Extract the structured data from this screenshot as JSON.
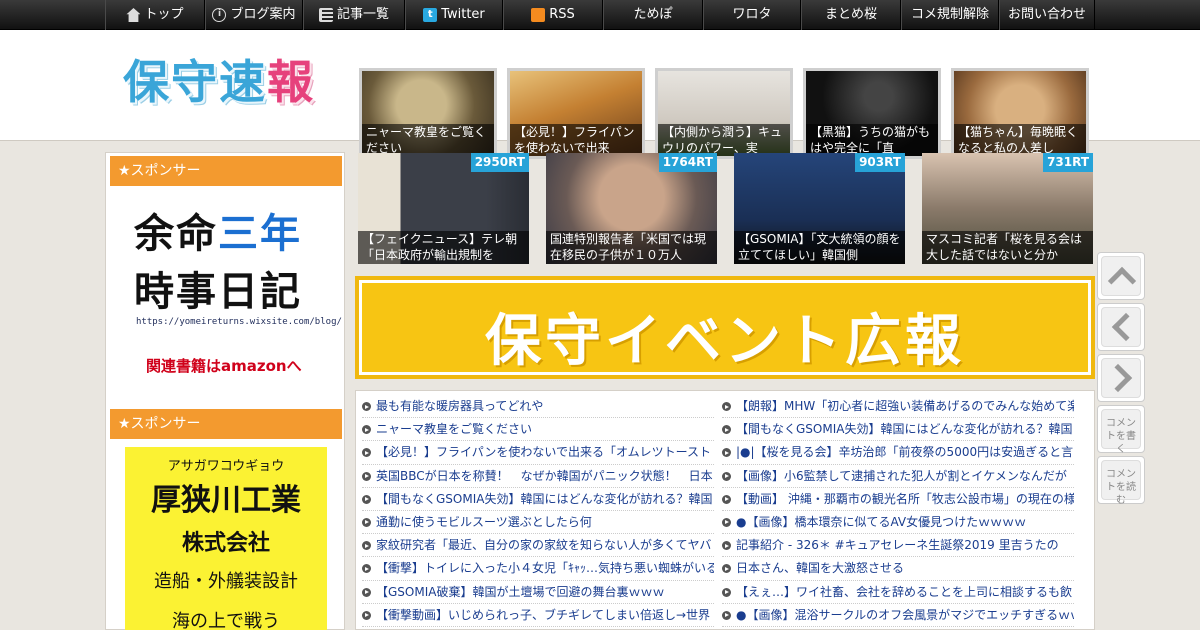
{
  "nav": {
    "items": [
      {
        "label": "トップ",
        "icon": "home-icon"
      },
      {
        "label": "ブログ案内",
        "icon": "info-icon"
      },
      {
        "label": "記事一覧",
        "icon": "list-icon"
      },
      {
        "label": "Twitter",
        "icon": "twitter-icon"
      },
      {
        "label": "RSS",
        "icon": "rss-icon"
      },
      {
        "label": "ためぽ"
      },
      {
        "label": "ワロタ"
      },
      {
        "label": "まとめ桜"
      },
      {
        "label": "コメ規制解除"
      },
      {
        "label": "お問い合わせ"
      }
    ]
  },
  "header": {
    "logo": {
      "part1": "保守",
      "part2": "速",
      "part3": "報"
    },
    "thumbs": [
      {
        "caption": "ニャーマ教皇をご覧ください",
        "color": "#7a6a4a"
      },
      {
        "caption": "【必見！】フライパンを使わないで出来",
        "color": "#b4783a"
      },
      {
        "caption": "【内側から潤う】キュウリのパワー、実",
        "color": "#c9c3b9"
      },
      {
        "caption": "【黒猫】うちの猫がもはや完全に「直",
        "color": "#2a2a2a"
      },
      {
        "caption": "【猫ちゃん】毎晩眠くなると私の人差し",
        "color": "#b38a5c"
      }
    ]
  },
  "sidebar": {
    "sponsor_title_1": "★スポンサー",
    "sponsor_title_2": "★スポンサー",
    "ad1": {
      "line1a": "余命",
      "line1b": "三年",
      "line2": "時事日記",
      "url": "https://yomeireturns.wixsite.com/blog/",
      "amazon": "関連書籍はamazonへ"
    },
    "ad2": {
      "kana": "アサガワコウギョウ",
      "name": "厚狭川工業",
      "corp": "株式会社",
      "biz": "造船・外艤装設計",
      "more": "海の上で戦う"
    }
  },
  "ranking": [
    {
      "rt": "2950RT",
      "caption": "【フェイクニュース】テレ朝「日本政府が輸出規制を",
      "color": "#4a4f5a"
    },
    {
      "rt": "1764RT",
      "caption": "国連特別報告者「米国では現在移民の子供が１０万人",
      "color": "#7b6e66"
    },
    {
      "rt": "903RT",
      "caption": "【GSOMIA】「文大統領の顔を立ててほしい」韓国側",
      "color": "#203a6a"
    },
    {
      "rt": "731RT",
      "caption": "マスコミ記者「桜を見る会は大した話ではないと分か",
      "color": "#6f7f5a"
    }
  ],
  "banner": {
    "text": "保守イベント広報"
  },
  "articles": {
    "left": [
      "最も有能な暖房器具ってどれや",
      "ニャーマ教皇をご覧ください",
      "【必見！】フライパンを使わないで出来る「オムレツトースト",
      "英国BBCが日本を称賛！　なぜか韓国がパニック状態！　日本",
      "【間もなくGSOMIA失効】韓国にはどんな変化が訪れる？韓国",
      "通勤に使うモビルスーツ選ぶとしたら何",
      "家紋研究者「最近、自分の家の家紋を知らない人が多くてヤバ",
      "【衝撃】トイレに入った小４女児「ｷｬｯ…気持ち悪い蜘蛛がいる",
      "【GSOMIA破棄】韓国が土壇場で回避の舞台裏ｗｗｗ",
      "【衝撃動画】いじめられっ子、ブチギレてしまい倍返し→世界"
    ],
    "right": [
      "【朗報】MHW「初心者に超強い装備あげるのでみんな始めて楽",
      "【間もなくGSOMIA失効】韓国にはどんな変化が訪れる？韓国",
      "|●|【桜を見る会】辛坊治郎「前夜祭の5000円は安過ぎると言っ",
      "【画像】小6監禁して逮捕された犯人が割とイケメンなんだが",
      "【動画】 沖縄・那覇市の観光名所「牧志公設市場」の現在の様",
      "●【画像】橋本環奈に似てるAV女優見つけたｗｗｗｗ",
      "記事紹介 - 326＊ #キュアセレーネ生誕祭2019 里吉うたの",
      "日本さん、韓国を大激怒させる",
      "【えぇ…】ワイ社畜、会社を辞めることを上司に相談するも飲",
      "●【画像】混浴サークルのオフ会風景がマジでエッチすぎるｗｗ"
    ]
  },
  "floating": {
    "write_comment": "コメントを書く",
    "read_comment": "コメントを読む"
  }
}
